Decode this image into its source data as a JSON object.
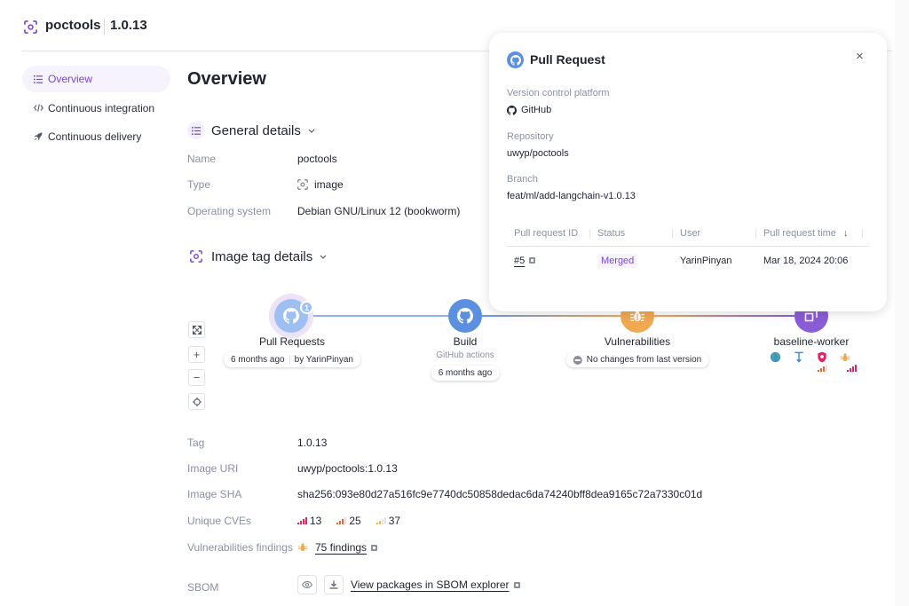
{
  "header": {
    "app_name": "poctools",
    "version": "1.0.13"
  },
  "sidebar": {
    "items": [
      {
        "label": "Overview",
        "icon": "list-icon",
        "active": true
      },
      {
        "label": "Continuous integration",
        "icon": "code-icon",
        "active": false
      },
      {
        "label": "Continuous delivery",
        "icon": "rocket-icon",
        "active": false
      }
    ]
  },
  "main": {
    "title": "Overview",
    "general_details": {
      "title": "General details",
      "rows": [
        {
          "label": "Name",
          "value": "poctools"
        },
        {
          "label": "Type",
          "value": "image"
        },
        {
          "label": "Operating system",
          "value": "Debian GNU/Linux 12 (bookworm)"
        }
      ]
    },
    "image_tag_details": {
      "title": "Image tag details",
      "pipeline": {
        "nodes": [
          {
            "name": "Pull Requests",
            "icon": "github-icon",
            "color": "#9dbff2",
            "badge": "1",
            "pill": [
              "6 months ago",
              "by YarinPinyan"
            ]
          },
          {
            "name": "Build",
            "icon": "github-icon",
            "color": "#5b8fe0",
            "subtitle": "GitHub actions",
            "pill": [
              "6 months ago"
            ]
          },
          {
            "name": "Vulnerabilities",
            "icon": "bug-icon",
            "color": "#f0a851",
            "pill": [
              "No changes from last version"
            ]
          },
          {
            "name": "baseline-worker",
            "icon": "deploy-icon",
            "color": "#8a5cd6",
            "env_icons": [
              "globe-icon",
              "tool-icon",
              "shield-icon",
              "bug-icon"
            ]
          }
        ],
        "controls": [
          "fit-view",
          "zoom-in",
          "zoom-out",
          "center"
        ]
      },
      "rows": [
        {
          "label": "Tag",
          "value": "1.0.13"
        },
        {
          "label": "Image URI",
          "value": "uwyp/poctools:1.0.13"
        },
        {
          "label": "Image SHA",
          "value": "sha256:093e80d27a516fc9e7740dc50858dedac6da74240bff8dea9165c72a7330c01d"
        }
      ],
      "unique_cves": {
        "label": "Unique CVEs",
        "critical": "13",
        "high": "25",
        "medium": "37",
        "colors": {
          "critical": "#e0245e",
          "high": "#f0642d",
          "medium": "#f5b942"
        }
      },
      "vulnerabilities_findings": {
        "label": "Vulnerabilities findings",
        "value": "75 findings"
      },
      "sbom": {
        "label": "SBOM",
        "link": "View packages in SBOM explorer"
      }
    }
  },
  "popup": {
    "title": "Pull Request",
    "close_label": "×",
    "version_control_label": "Version control platform",
    "version_control_value": "GitHub",
    "repository_label": "Repository",
    "repository_value": "uwyp/poctools",
    "branch_label": "Branch",
    "branch_value": "feat/ml/add-langchain-v1.0.13",
    "table": {
      "columns": [
        "Pull request ID",
        "Status",
        "User",
        "Pull request time"
      ],
      "sort_indicator": "↓",
      "rows": [
        {
          "id": "#5",
          "status": "Merged",
          "user": "YarinPinyan",
          "time": "Mar 18, 2024 20:06"
        }
      ]
    }
  }
}
